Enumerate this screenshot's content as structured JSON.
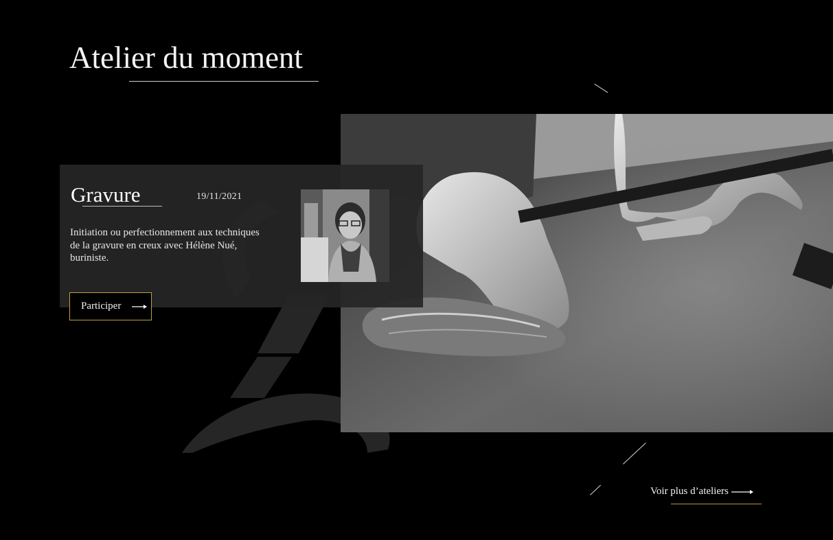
{
  "section": {
    "title": "Atelier du moment"
  },
  "workshop": {
    "title": "Gravure",
    "date": "19/11/2021",
    "description": "Initiation ou perfectionnement aux techniques de la gravure en creux avec Hélène Nué, buriniste.",
    "cta_label": "Participer",
    "cta_icon": "arrow-right-icon",
    "portrait_icon": "portrait-photo",
    "hero_icon": "engraving-hands-photo"
  },
  "more": {
    "label": "Voir plus d’ateliers",
    "icon": "arrow-right-icon"
  },
  "colors": {
    "background": "#000000",
    "card": "#262626",
    "accent_gold": "#c2a13f",
    "text": "#ffffff"
  }
}
